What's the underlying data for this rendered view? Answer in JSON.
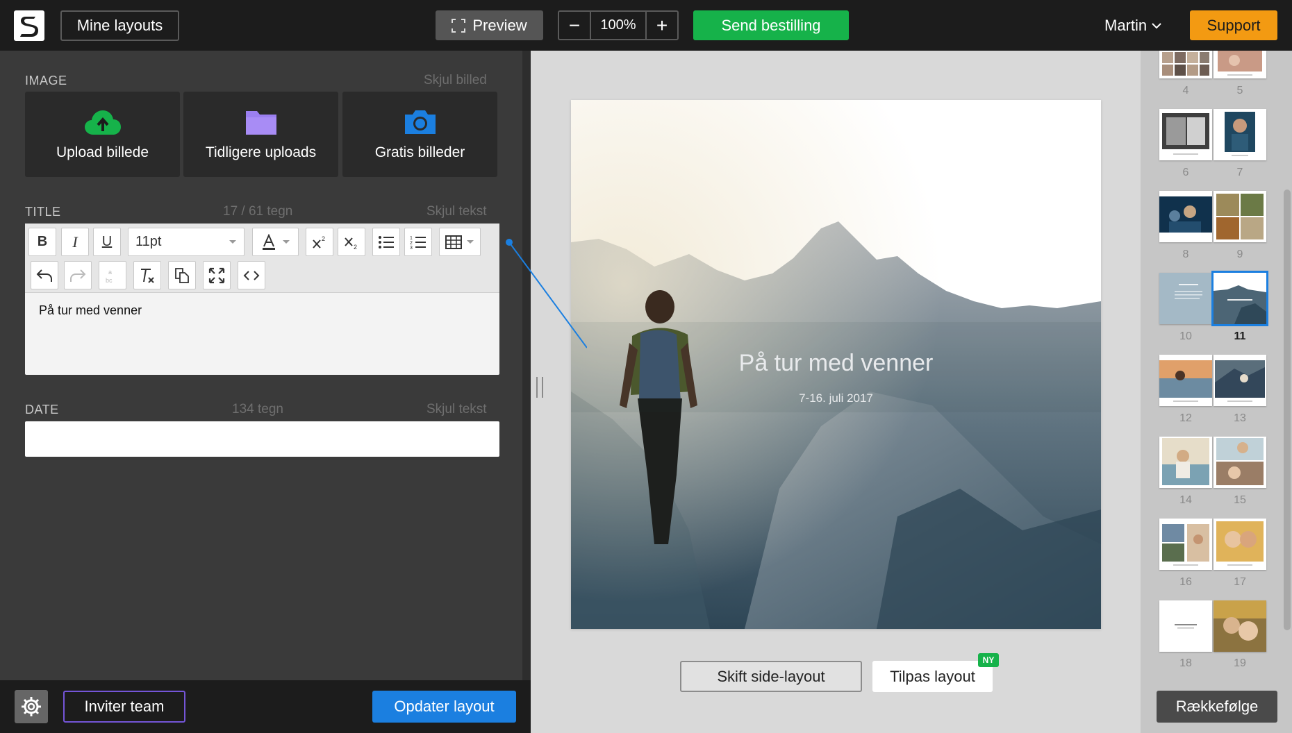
{
  "topbar": {
    "logo_letter": "S",
    "my_layouts": "Mine layouts",
    "preview": "Preview",
    "zoom_minus": "−",
    "zoom_value": "100%",
    "zoom_plus": "+",
    "send_order": "Send bestilling",
    "user_name": "Martin",
    "support": "Support"
  },
  "image_section": {
    "label": "IMAGE",
    "hide": "Skjul billed",
    "cards": [
      {
        "label": "Upload billede",
        "icon": "cloud-upload-icon",
        "color": "#16b24a"
      },
      {
        "label": "Tidligere uploads",
        "icon": "folder-icon",
        "color": "#9b7ff0"
      },
      {
        "label": "Gratis billeder",
        "icon": "camera-icon",
        "color": "#1b7fe0"
      }
    ]
  },
  "title_section": {
    "label": "TITLE",
    "count": "17 / 61 tegn",
    "hide": "Skjul tekst",
    "font_size": "11pt",
    "text": "På tur med venner"
  },
  "date_section": {
    "label": "DATE",
    "count": "134 tegn",
    "hide": "Skjul tekst",
    "value": ""
  },
  "footer_left": {
    "invite": "Inviter team",
    "update": "Opdater layout"
  },
  "page": {
    "title": "På tur med venner",
    "date": "7-16. juli 2017"
  },
  "canvas_buttons": {
    "change_layout": "Skift side-layout",
    "customize_layout": "Tilpas layout",
    "new_badge": "NY"
  },
  "thumbnails": [
    {
      "num": "4"
    },
    {
      "num": "5"
    },
    {
      "num": "6"
    },
    {
      "num": "7"
    },
    {
      "num": "8"
    },
    {
      "num": "9"
    },
    {
      "num": "10"
    },
    {
      "num": "11",
      "current": true
    },
    {
      "num": "12"
    },
    {
      "num": "13"
    },
    {
      "num": "14"
    },
    {
      "num": "15"
    },
    {
      "num": "16"
    },
    {
      "num": "17"
    },
    {
      "num": "18"
    },
    {
      "num": "19"
    }
  ],
  "footer_right": {
    "order": "Rækkefølge"
  },
  "colors": {
    "green": "#16b24a",
    "orange": "#f39a12",
    "blue": "#1b7fe0",
    "purple": "#7455d8",
    "dark": "#1c1c1c"
  }
}
